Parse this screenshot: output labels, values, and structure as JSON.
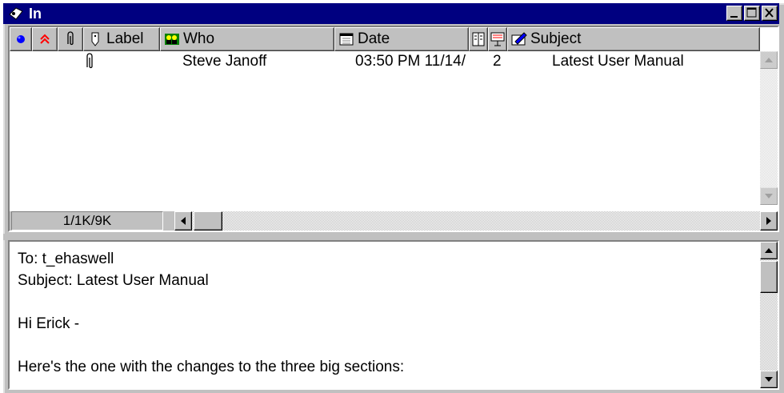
{
  "window": {
    "title": "In",
    "title_color": "#000080"
  },
  "columns": {
    "status_icon": "blue-dot-icon",
    "priority_icon": "priority-chevron-icon",
    "attachment_icon": "paperclip-icon",
    "label": "Label",
    "who": "Who",
    "date": "Date",
    "size_icon": "size-icon",
    "type_icon": "message-type-icon",
    "subject": "Subject"
  },
  "messages": [
    {
      "attachment_icon": "paperclip-icon",
      "who": "Steve Janoff",
      "date": "03:50 PM 11/14/",
      "size": "2",
      "subject": "Latest User Manual"
    }
  ],
  "status": {
    "counter": "1/1K/9K"
  },
  "preview": {
    "to": "To: t_ehaswell",
    "subject": "Subject: Latest User Manual",
    "blank1": "",
    "greeting": "Hi Erick -",
    "blank2": "",
    "line1": "Here's the one with the changes to the three big sections:"
  },
  "colors": {
    "chrome": "#c0c0c0",
    "priority": "#ff0000",
    "status_dot": "#0000ff"
  }
}
